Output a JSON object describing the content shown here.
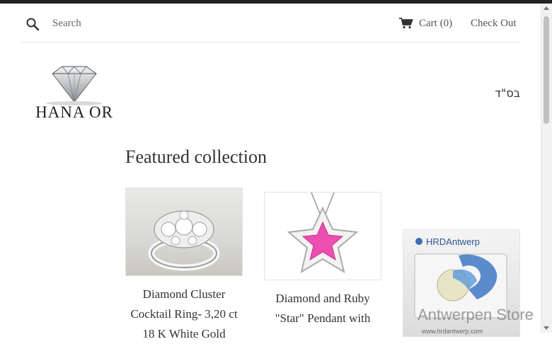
{
  "header": {
    "search_label": "Search",
    "search_placeholder": "Search",
    "cart_label": "Cart",
    "cart_count": "(0)",
    "checkout_label": "Check Out"
  },
  "brand": {
    "logo_text": "HANA OR",
    "bsd": "בס\"ד"
  },
  "main": {
    "heading": "Featured collection",
    "products": [
      {
        "title": "Diamond Cluster Cocktail Ring- 3,20 ct 18 K White Gold",
        "image": "diamond-cluster-ring"
      },
      {
        "title": "Diamond and Ruby \"Star\" Pendant with",
        "image": "star-pendant"
      },
      {
        "title": "",
        "image": "hrd-antwerp-certified-diamond"
      }
    ]
  },
  "watermark": {
    "text": "Antwerpen Store",
    "hrd_label": "HRDAntwerp",
    "hrd_url": "www.hrdantwerp.com"
  },
  "colors": {
    "topbar": "#222222",
    "text": "#333333",
    "link": "#555555",
    "divider": "#e5e5e5"
  }
}
